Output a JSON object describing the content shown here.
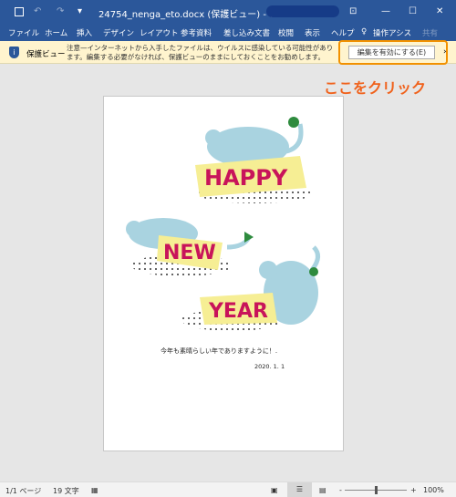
{
  "titlebar": {
    "title": "24754_nenga_eto.docx (保護ビュー) - Word"
  },
  "ribbon": {
    "tabs": [
      "ファイル",
      "ホーム",
      "挿入",
      "デザイン",
      "レイアウト",
      "参考資料",
      "差し込み文書",
      "校閲",
      "表示",
      "ヘルプ"
    ],
    "tell_me": "操作アシス",
    "share": "共有"
  },
  "protected_view": {
    "label": "保護ビュー",
    "message": "注意—インターネットから入手したファイルは、ウイルスに感染している可能性があります。編集する必要がなければ、保護ビューのままにしておくことをお勧めします。",
    "enable_button": "編集を有効にする(E)"
  },
  "annotation": "ここをクリック",
  "document": {
    "words": [
      "HAPPY",
      "NEW",
      "YEAR"
    ],
    "greeting": "今年も素晴らしい年でありますように！.",
    "date": "2020. 1. 1"
  },
  "status": {
    "page": "1/1 ページ",
    "words": "19 文字",
    "zoom": "100%",
    "zoom_level": 100
  },
  "colors": {
    "accent": "#2b579a",
    "highlight": "#f29100",
    "annotation": "#f0621c"
  }
}
